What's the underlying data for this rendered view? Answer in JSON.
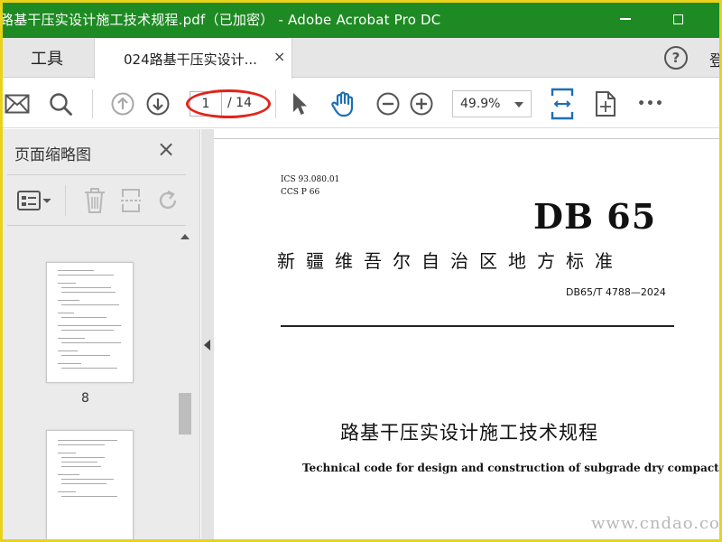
{
  "window": {
    "title": "路基干压实设计施工技术规程.pdf（已加密） - Adobe Acrobat Pro DC",
    "colors": {
      "titlebar": "#1e8a23",
      "frame": "#e8d21a",
      "highlight_oval": "#e2231a"
    }
  },
  "tabs": {
    "tools_label": "工具",
    "document_label": "024路基干压实设计...",
    "close_glyph": "×",
    "help_glyph": "?",
    "signin_label": "登"
  },
  "toolbar": {
    "current_page": "1",
    "total_pages": "/ 14",
    "zoom": "49.9%",
    "more_glyph": "•••"
  },
  "thumbnails_panel": {
    "title": "页面缩略图",
    "close_glyph": "×",
    "visible_page_number": "8"
  },
  "document": {
    "ics": "ICS  93.080.01",
    "ccs": "CCS  P  66",
    "db_logo": "DB 65",
    "standard_org": "新疆维吾尔自治区地方标准",
    "standard_code": "DB65/T 4788—2024",
    "title_zh": "路基干压实设计施工技术规程",
    "title_en": "Technical code for design and construction of subgrade dry compaction"
  },
  "watermark": "www.cndao.com"
}
